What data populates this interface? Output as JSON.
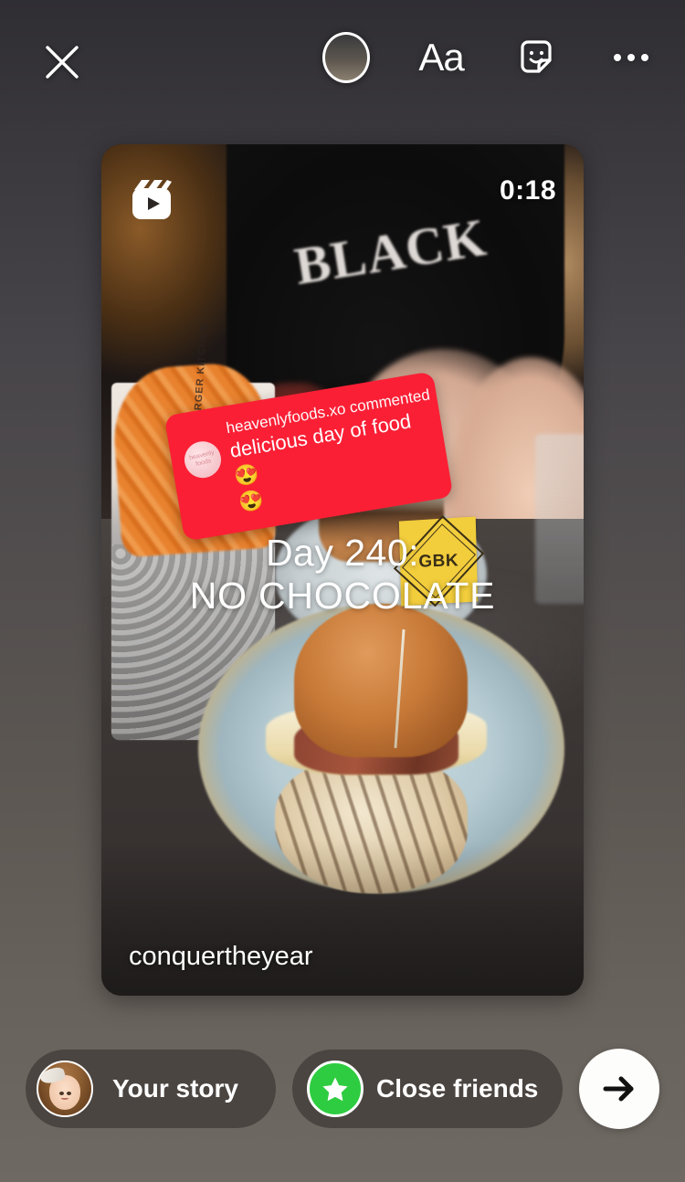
{
  "screen": {
    "app": "Instagram",
    "name": "story-share-editor"
  },
  "toolbar": {
    "close_label": "×",
    "close_icon": "close-icon",
    "tools": [
      {
        "id": "draw",
        "icon": "circle-color-tool-icon",
        "label": ""
      },
      {
        "id": "text",
        "icon": "text-tool-icon",
        "label": "Aa"
      },
      {
        "id": "sticker",
        "icon": "sticker-icon",
        "label": ""
      },
      {
        "id": "more",
        "icon": "more-options-icon",
        "label": ""
      }
    ]
  },
  "preview": {
    "media_type_icon": "reels-icon",
    "duration": "0:18",
    "username": "conquertheyear",
    "caption": {
      "line1": "Day 240:",
      "line2": "NO CHOCOLATE"
    },
    "scene": {
      "shirt_text": "BLACK",
      "flag_brand": "GBK",
      "fries_cup_label": "GOURMET BURGER KITCHEN"
    }
  },
  "comment_sticker": {
    "avatar_name": "commenter-avatar",
    "avatar_caption": "heavenly foods",
    "header": "heavenlyfoods.xo commented",
    "text": "delicious day of food 😍",
    "text_line2": "😍",
    "background_color": "#fa1f35",
    "text_color": "#ffffff"
  },
  "actions": {
    "your_story": {
      "label": "Your story",
      "avatar_name": "your-story-avatar"
    },
    "close_friends": {
      "label": "Close friends",
      "badge_icon": "green-star-icon",
      "badge_color": "#2ecc40"
    },
    "send": {
      "icon": "arrow-right-icon",
      "label": ""
    }
  },
  "colors": {
    "background_top": "#2f2e33",
    "background_bottom": "#6f6963",
    "pill": "#4b4541",
    "accent_red": "#fa1f35",
    "accent_green": "#2ecc40"
  }
}
